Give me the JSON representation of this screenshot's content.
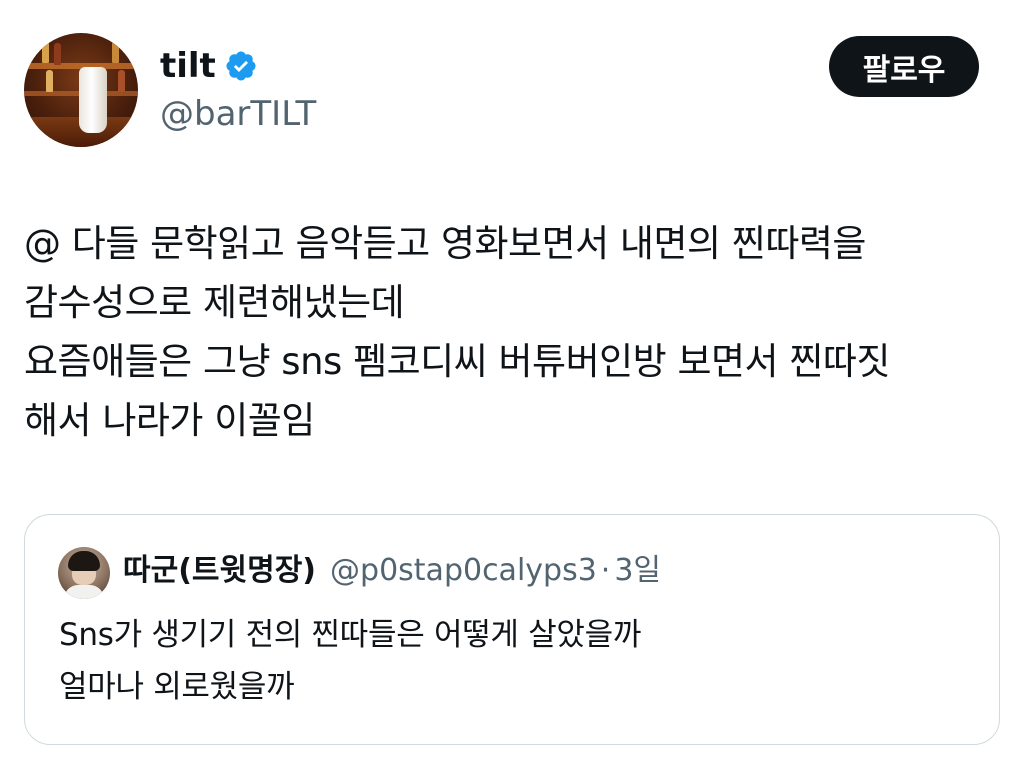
{
  "author": {
    "name": "tilt",
    "handle": "@barTILT",
    "verified_icon": "verified-badge-icon",
    "badge_color": "#1d9bf0"
  },
  "follow_button": {
    "label": "팔로우"
  },
  "tweet": {
    "lines": [
      "@ 다들 문학읽고 음악듣고 영화보면서 내면의 찐따력을",
      "감수성으로 제련해냈는데",
      "요즘애들은 그냥 sns 펨코디씨 버튜버인방 보면서 찐따짓",
      "해서 나라가 이꼴임"
    ]
  },
  "quote": {
    "name": "따군(트윗명장)",
    "handle": "@p0stap0calyps3",
    "separator": "·",
    "time": "3일",
    "lines": [
      "Sns가 생기기 전의 찐따들은 어떻게 살았을까",
      "얼마나 외로웠을까"
    ]
  }
}
